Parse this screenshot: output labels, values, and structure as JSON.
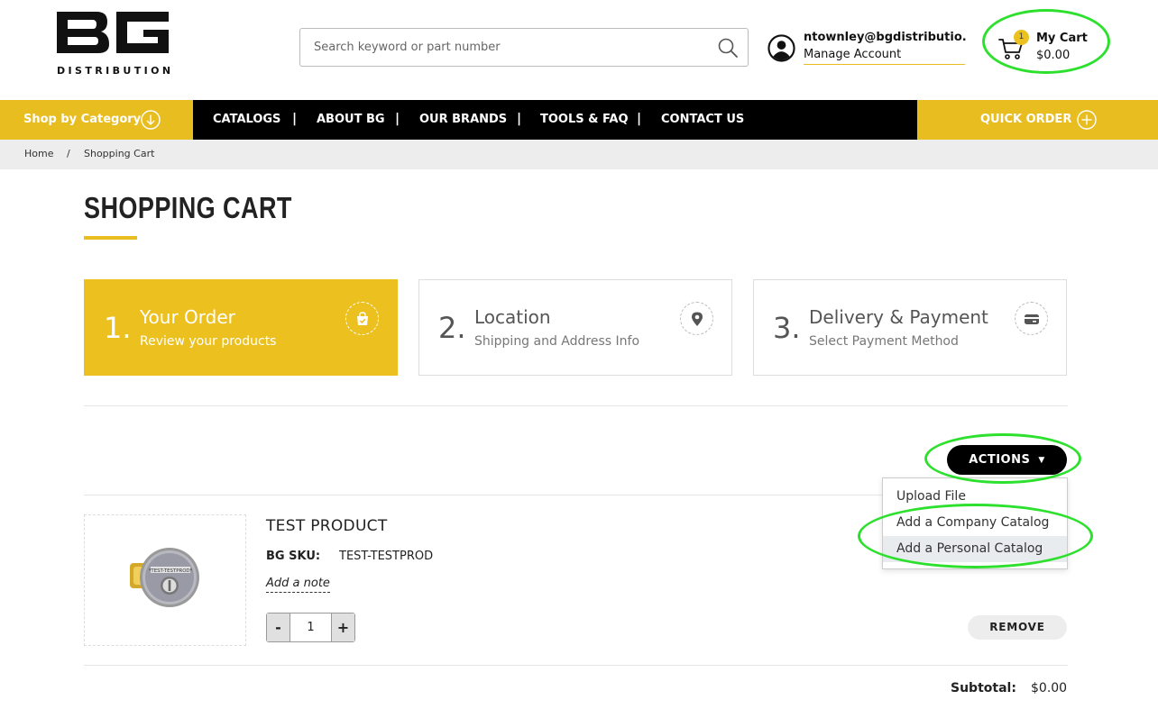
{
  "header": {
    "logo_text": "BG",
    "logo_subtext": "DISTRIBUTION",
    "search_placeholder": "Search keyword or part number",
    "user_email": "ntownley@bgdistributio...",
    "manage_account": "Manage Account",
    "cart_label": "My Cart",
    "cart_total": "$0.00",
    "cart_count": "1"
  },
  "nav": {
    "shop_by_category": "Shop by Category",
    "items": [
      "CATALOGS",
      "ABOUT BG",
      "OUR BRANDS",
      "TOOLS & FAQ",
      "CONTACT US"
    ],
    "separator": "|",
    "quick_order": "QUICK ORDER"
  },
  "breadcrumb": {
    "home": "Home",
    "separator": "/",
    "current": "Shopping Cart"
  },
  "page_title": "SHOPPING CART",
  "steps": [
    {
      "num": "1.",
      "title": "Your Order",
      "subtitle": "Review your products",
      "icon": "shopping-bag-check-icon"
    },
    {
      "num": "2.",
      "title": "Location",
      "subtitle": "Shipping and Address Info",
      "icon": "map-pin-icon"
    },
    {
      "num": "3.",
      "title": "Delivery & Payment",
      "subtitle": "Select Payment Method",
      "icon": "credit-card-icon"
    }
  ],
  "actions": {
    "label": "ACTIONS",
    "menu": [
      "Upload File",
      "Add a Company Catalog",
      "Add a Personal Catalog"
    ]
  },
  "product": {
    "name": "TEST PRODUCT",
    "sku_label": "BG SKU:",
    "sku": "TEST-TESTPROD",
    "note_label": "Add a note",
    "image_text": "*TEST-TESTPROD*",
    "qty": "1",
    "minus": "-",
    "plus": "+",
    "remove_label": "REMOVE"
  },
  "subtotal": {
    "label": "Subtotal:",
    "value": "$0.00"
  },
  "colors": {
    "accent": "#e8bd20",
    "nav_bg": "#000000",
    "annotation": "#2ee02e"
  }
}
